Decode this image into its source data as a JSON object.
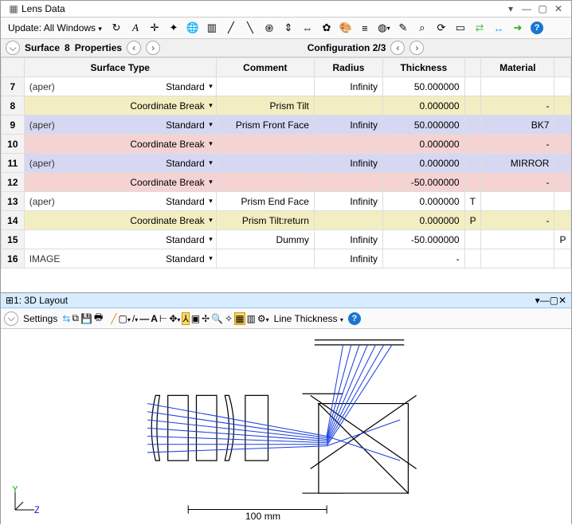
{
  "title": {
    "label": "Lens Data"
  },
  "toolbar1": {
    "update_label": "Update: All Windows",
    "icons": [
      "refresh-icon",
      "eye-icon",
      "target-icon",
      "plus-icon",
      "globe-icon",
      "grid-icon",
      "scissors-icon",
      "move-icon",
      "link-icon",
      "arrow-icon",
      "wand-icon",
      "lens-icon",
      "brush-icon",
      "palette-icon",
      "layers-icon",
      "ring-icon",
      "pencil-icon",
      "switch-icon",
      "swap-icon",
      "page-icon",
      "swap2-icon",
      "arrowright-icon",
      "goarrow-icon",
      "help-icon"
    ]
  },
  "subbar": {
    "surface_label": "Surface",
    "number": "8",
    "properties_label": "Properties",
    "config_label": "Configuration 2/3"
  },
  "columns": [
    "",
    "Surface Type",
    "Comment",
    "Radius",
    "Thickness",
    "",
    "Material",
    ""
  ],
  "rows": [
    {
      "n": "7",
      "cls": "",
      "aper": "(aper)",
      "stype": "Standard",
      "comment": "",
      "radius": "Infinity",
      "thick": "50.000000",
      "flag": "",
      "mat": "",
      "f2": ""
    },
    {
      "n": "8",
      "cls": "yellow",
      "aper": "",
      "stype": "Coordinate Break",
      "comment": "Prism Tilt",
      "radius": "",
      "thick": "0.000000",
      "flag": "",
      "mat": "-",
      "f2": ""
    },
    {
      "n": "9",
      "cls": "blue",
      "aper": "(aper)",
      "stype": "Standard",
      "comment": "Prism Front Face",
      "radius": "Infinity",
      "thick": "50.000000",
      "flag": "",
      "mat": "BK7",
      "f2": ""
    },
    {
      "n": "10",
      "cls": "pink",
      "aper": "",
      "stype": "Coordinate Break",
      "comment": "",
      "radius": "",
      "thick": "0.000000",
      "flag": "",
      "mat": "-",
      "f2": ""
    },
    {
      "n": "11",
      "cls": "blue",
      "aper": "(aper)",
      "stype": "Standard",
      "comment": "",
      "radius": "Infinity",
      "thick": "0.000000",
      "flag": "",
      "mat": "MIRROR",
      "f2": ""
    },
    {
      "n": "12",
      "cls": "pink",
      "aper": "",
      "stype": "Coordinate Break",
      "comment": "",
      "radius": "",
      "thick": "-50.000000",
      "flag": "",
      "mat": "-",
      "f2": ""
    },
    {
      "n": "13",
      "cls": "",
      "aper": "(aper)",
      "stype": "Standard",
      "comment": "Prism End Face",
      "radius": "Infinity",
      "thick": "0.000000",
      "flag": "T",
      "mat": "",
      "f2": ""
    },
    {
      "n": "14",
      "cls": "yellow",
      "aper": "",
      "stype": "Coordinate Break",
      "comment": "Prism Tilt:return",
      "radius": "",
      "thick": "0.000000",
      "flag": "P",
      "mat": "-",
      "f2": ""
    },
    {
      "n": "15",
      "cls": "",
      "aper": "",
      "stype": "Standard",
      "comment": "Dummy",
      "radius": "Infinity",
      "thick": "-50.000000",
      "flag": "",
      "mat": "",
      "f2": "P"
    },
    {
      "n": "16",
      "cls": "",
      "aper": "IMAGE",
      "stype": "Standard",
      "comment": "",
      "radius": "Infinity",
      "thick": "-",
      "flag": "",
      "mat": "",
      "f2": ""
    }
  ],
  "layout": {
    "title": "1: 3D Layout",
    "settings_label": "Settings",
    "line_label": "Line Thickness",
    "scale": "100 mm",
    "axis_y": "Y",
    "axis_z": "Z"
  }
}
